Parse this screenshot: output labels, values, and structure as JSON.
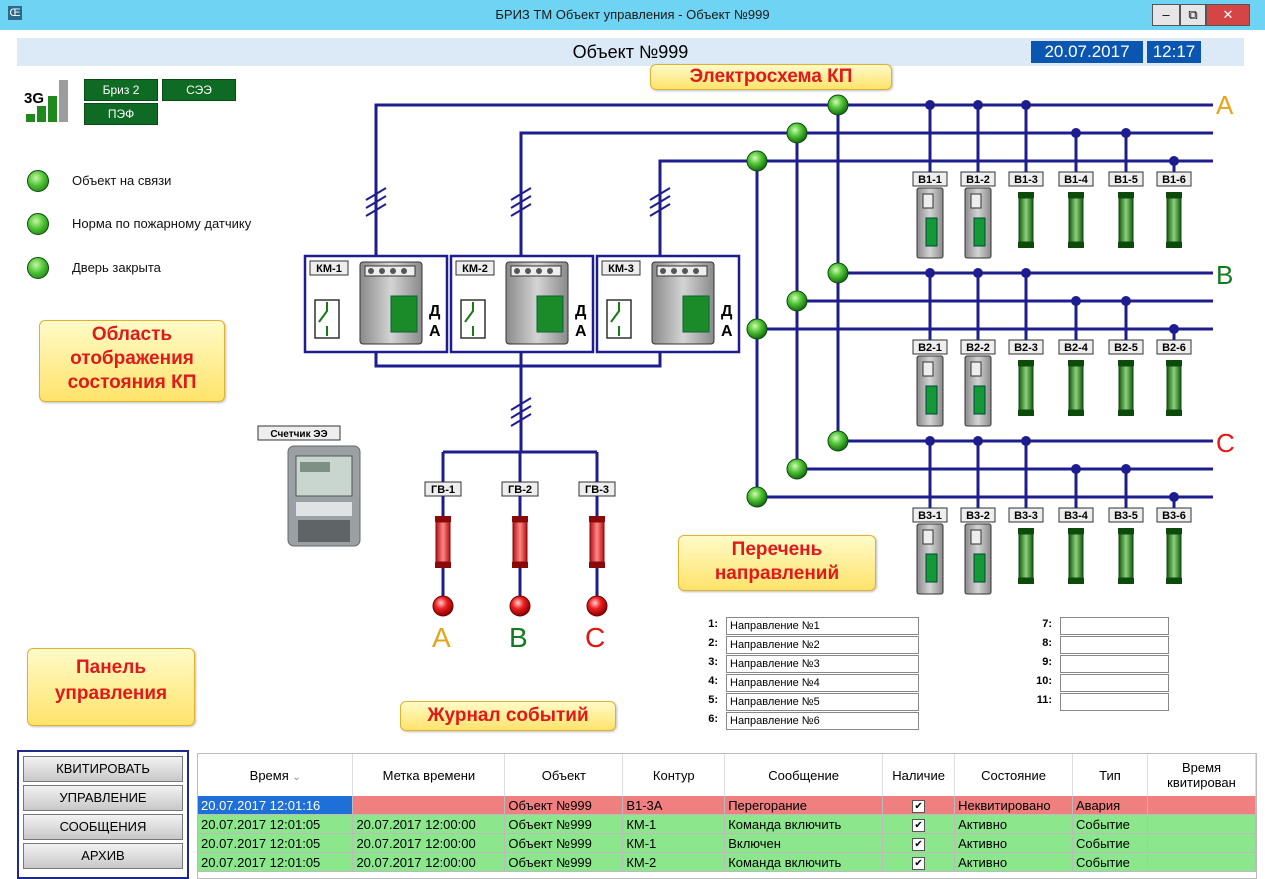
{
  "window": {
    "title": "БРИЗ ТМ Объект управления - Объект №999",
    "app_icon": "Œ"
  },
  "header": {
    "object_title": "Объект №999",
    "date": "20.07.2017",
    "time": "12:17"
  },
  "signal": {
    "label": "3G"
  },
  "modules": {
    "briz": "Бриз 2",
    "see": "СЭЭ",
    "pef": "ПЭФ"
  },
  "status": [
    {
      "label": "Объект на связи"
    },
    {
      "label": "Норма по пожарному датчику"
    },
    {
      "label": "Дверь закрыта"
    }
  ],
  "callouts": {
    "scheme": "Электросхема КП",
    "status_area": "Область отображения состояния КП",
    "directions": "Перечень направлений",
    "panel": "Панель управления",
    "journal": "Журнал событий"
  },
  "scheme": {
    "phases": [
      "A",
      "B",
      "C"
    ],
    "contactors": [
      "КМ-1",
      "КМ-2",
      "КМ-3"
    ],
    "contactor_mode": [
      "Д",
      "А"
    ],
    "meter_label": "Счетчик ЭЭ",
    "input_fuses": [
      "ГВ-1",
      "ГВ-2",
      "ГВ-3"
    ],
    "outputs": {
      "A": [
        "В1-1",
        "В1-2",
        "В1-3",
        "В1-4",
        "В1-5",
        "В1-6"
      ],
      "B": [
        "В2-1",
        "В2-2",
        "В2-3",
        "В2-4",
        "В2-5",
        "В2-6"
      ],
      "C": [
        "В3-1",
        "В3-2",
        "В3-3",
        "В3-4",
        "В3-5",
        "В3-6"
      ]
    }
  },
  "directions": {
    "left": [
      {
        "num": "1:",
        "name": "Направление №1"
      },
      {
        "num": "2:",
        "name": "Направление №2"
      },
      {
        "num": "3:",
        "name": "Направление №3"
      },
      {
        "num": "4:",
        "name": "Направление №4"
      },
      {
        "num": "5:",
        "name": "Направление №5"
      },
      {
        "num": "6:",
        "name": "Направление №6"
      }
    ],
    "right": [
      {
        "num": "7:",
        "name": ""
      },
      {
        "num": "8:",
        "name": ""
      },
      {
        "num": "9:",
        "name": ""
      },
      {
        "num": "10:",
        "name": ""
      },
      {
        "num": "11:",
        "name": ""
      }
    ]
  },
  "panel": {
    "buttons": [
      "КВИТИРОВАТЬ",
      "УПРАВЛЕНИЕ",
      "СООБЩЕНИЯ",
      "АРХИВ"
    ]
  },
  "journal": {
    "columns": [
      "Время",
      "Метка времени",
      "Объект",
      "Контур",
      "Сообщение",
      "Наличие",
      "Состояние",
      "Тип",
      "Время квитирован"
    ],
    "rows": [
      {
        "status": "alarm",
        "cells": [
          "20.07.2017 12:01:16",
          "",
          "Объект №999",
          "В1-3А",
          "Перегорание",
          "✔",
          "Неквитировано",
          "Авария",
          ""
        ]
      },
      {
        "status": "ok",
        "cells": [
          "20.07.2017 12:01:05",
          "20.07.2017 12:00:00",
          "Объект №999",
          "КМ-1",
          "Команда включить",
          "✔",
          "Активно",
          "Событие",
          ""
        ]
      },
      {
        "status": "ok",
        "cells": [
          "20.07.2017 12:01:05",
          "20.07.2017 12:00:00",
          "Объект №999",
          "КМ-1",
          "Включен",
          "✔",
          "Активно",
          "Событие",
          ""
        ]
      },
      {
        "status": "ok",
        "cells": [
          "20.07.2017 12:01:05",
          "20.07.2017 12:00:00",
          "Объект №999",
          "КМ-2",
          "Команда включить",
          "✔",
          "Активно",
          "Событие",
          ""
        ]
      }
    ]
  },
  "colors": {
    "phase_a": "#e6a417",
    "phase_b": "#137a1f",
    "phase_c": "#e81414",
    "wire": "#1d1d8f",
    "date_bg": "#0a56b0",
    "titlebar": "#6fd4f3"
  }
}
